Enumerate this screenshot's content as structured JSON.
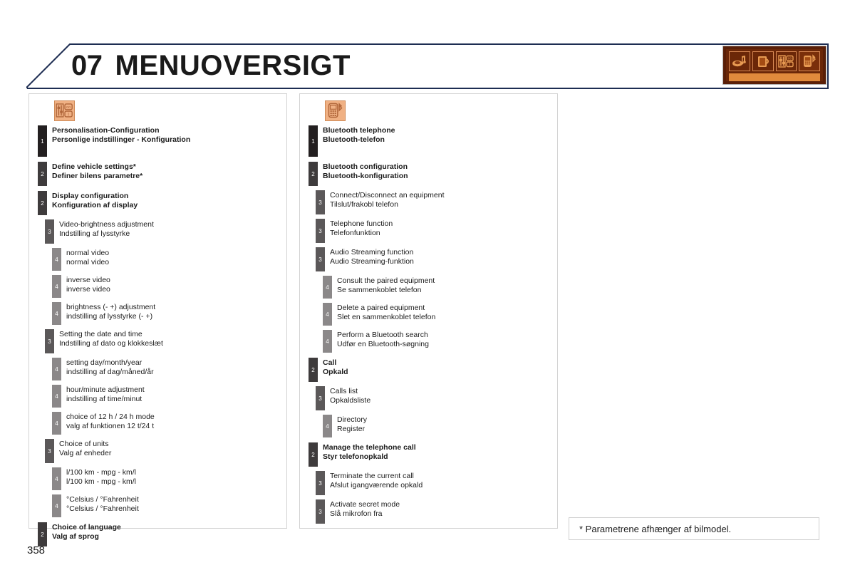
{
  "header": {
    "chapter_number": "07",
    "chapter_title": "MENUOVERSIGT",
    "border_color": "#1d2d52"
  },
  "icon_strip": {
    "background_color": "#5a1f07",
    "accent_color": "#e08a3c",
    "icons": [
      {
        "name": "media-music-icon",
        "label": "Media"
      },
      {
        "name": "radio-cup-icon",
        "label": "Radio"
      },
      {
        "name": "settings-sliders-icon",
        "label": "Personalisation-Configuration"
      },
      {
        "name": "bluetooth-phone-icon",
        "label": "Bluetooth telephone"
      }
    ],
    "active_index": 3
  },
  "cards": [
    {
      "id": "personalisation",
      "icon_name": "settings-sliders-icon",
      "icon_color": "#f0b184",
      "rows": [
        {
          "level": 1,
          "en": "Personalisation-Configuration",
          "da": "Personlige indstillinger - Konfiguration"
        },
        {
          "level": 2,
          "en": "Define vehicle settings*",
          "da": "Definer bilens parametre*"
        },
        {
          "level": 2,
          "en": "Display configuration",
          "da": "Konfiguration af display"
        },
        {
          "level": 3,
          "en": "Video-brightness adjustment",
          "da": "Indstilling af lysstyrke"
        },
        {
          "level": 4,
          "en": "normal video",
          "da": "normal video"
        },
        {
          "level": 4,
          "en": "inverse video",
          "da": "inverse video"
        },
        {
          "level": 4,
          "en": "brightness (- +) adjustment",
          "da": "indstilling af lysstyrke (- +)"
        },
        {
          "level": 3,
          "en": "Setting the date and time",
          "da": "Indstilling af dato og klokkeslæt"
        },
        {
          "level": 4,
          "en": "setting day/month/year",
          "da": "indstilling af dag/måned/år"
        },
        {
          "level": 4,
          "en": "hour/minute adjustment",
          "da": "indstilling af time/minut"
        },
        {
          "level": 4,
          "en": "choice of 12 h / 24 h mode",
          "da": "valg af funktionen 12 t/24 t"
        },
        {
          "level": 3,
          "en": "Choice of units",
          "da": "Valg af enheder"
        },
        {
          "level": 4,
          "en": "l/100 km - mpg - km/l",
          "da": "l/100 km - mpg - km/l"
        },
        {
          "level": 4,
          "en": "°Celsius / °Fahrenheit",
          "da": "°Celsius / °Fahrenheit"
        },
        {
          "level": 2,
          "en": "Choice of language",
          "da": "Valg af sprog"
        }
      ]
    },
    {
      "id": "bluetooth",
      "icon_name": "bluetooth-phone-icon",
      "icon_color": "#f0b184",
      "rows": [
        {
          "level": 1,
          "en": "Bluetooth telephone",
          "da": "Bluetooth-telefon"
        },
        {
          "level": 2,
          "en": "Bluetooth configuration",
          "da": "Bluetooth-konfiguration"
        },
        {
          "level": 3,
          "en": "Connect/Disconnect an equipment",
          "da": "Tilslut/frakobl telefon"
        },
        {
          "level": 3,
          "en": "Telephone function",
          "da": "Telefonfunktion"
        },
        {
          "level": 3,
          "en": "Audio Streaming function",
          "da": "Audio Streaming-funktion"
        },
        {
          "level": 4,
          "en": "Consult the paired equipment",
          "da": "Se sammenkoblet telefon"
        },
        {
          "level": 4,
          "en": "Delete a paired equipment",
          "da": "Slet en sammenkoblet telefon"
        },
        {
          "level": 4,
          "en": "Perform a Bluetooth search",
          "da": "Udfør en Bluetooth-søgning"
        },
        {
          "level": 2,
          "en": "Call",
          "da": "Opkald"
        },
        {
          "level": 3,
          "en": "Calls list",
          "da": "Opkaldsliste"
        },
        {
          "level": 4,
          "en": "Directory",
          "da": "Register"
        },
        {
          "level": 2,
          "en": "Manage the telephone call",
          "da": "Styr telefonopkald"
        },
        {
          "level": 3,
          "en": "Terminate the current call",
          "da": "Afslut igangværende opkald"
        },
        {
          "level": 3,
          "en": "Activate secret mode",
          "da": "Slå mikrofon fra"
        }
      ]
    }
  ],
  "footnote": "* Parametrene afhænger af bilmodel.",
  "page_number": "358",
  "level_colors": {
    "1": "#231f20",
    "2": "#3e3b3c",
    "3": "#5b5859",
    "4": "#8b8889"
  }
}
